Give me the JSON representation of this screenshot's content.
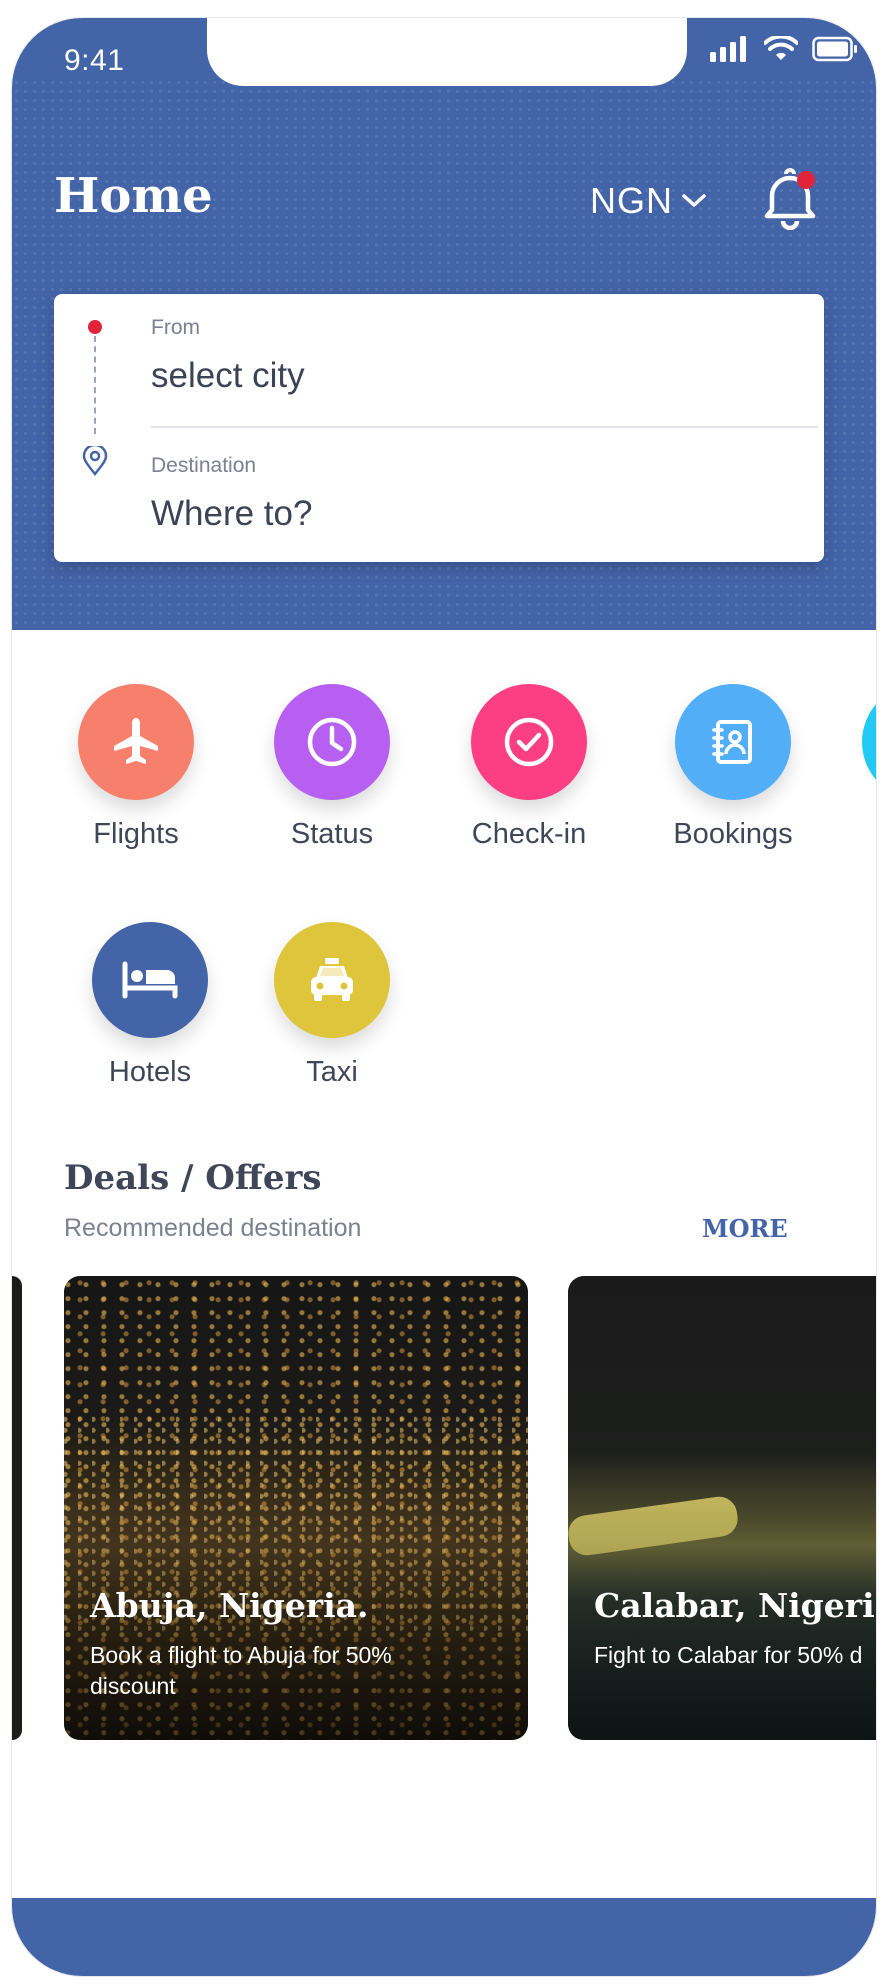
{
  "status_bar": {
    "time": "9:41"
  },
  "header": {
    "title": "Home",
    "currency": "NGN",
    "colors": {
      "primary": "#4464a8",
      "notification_dot": "#e0253b"
    }
  },
  "search": {
    "from_label": "From",
    "from_value": "select city",
    "destination_label": "Destination",
    "destination_value": "Where to?"
  },
  "services": [
    {
      "label": "Flights",
      "icon": "airplane-icon",
      "color": "#f7806c"
    },
    {
      "label": "Status",
      "icon": "clock-icon",
      "color": "#b65ff0"
    },
    {
      "label": "Check-in",
      "icon": "check-circle-icon",
      "color": "#fb3f82"
    },
    {
      "label": "Bookings",
      "icon": "contact-book-icon",
      "color": "#53aef8"
    },
    {
      "label": "Hotels",
      "icon": "bed-icon",
      "color": "#4464a8"
    },
    {
      "label": "Taxi",
      "icon": "taxi-icon",
      "color": "#dfc53c"
    }
  ],
  "deals": {
    "title": "Deals / Offers",
    "subtitle": "Recommended destination",
    "more_label": "MORE",
    "cards": [
      {
        "title": "Abuja, Nigeria.",
        "description": "Book a flight to Abuja for 50% discount"
      },
      {
        "title": "Calabar, Nigeria.",
        "description": "Fight to Calabar for 50% d"
      }
    ]
  }
}
